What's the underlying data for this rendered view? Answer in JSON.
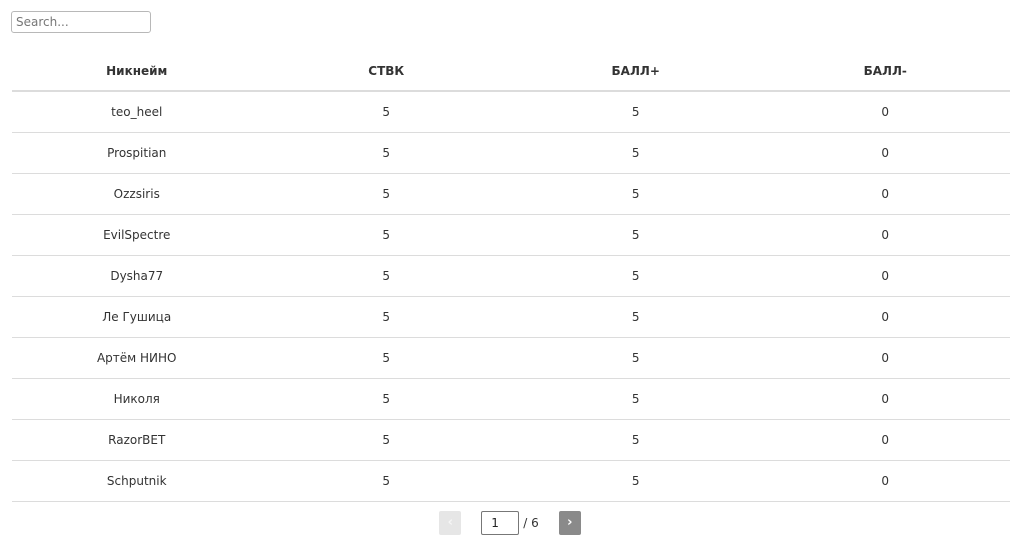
{
  "search": {
    "placeholder": "Search...",
    "value": ""
  },
  "table": {
    "columns": [
      "Никнейм",
      "СТВК",
      "БАЛЛ+",
      "БАЛЛ-"
    ],
    "rows": [
      [
        "teo_heel",
        "5",
        "5",
        "0"
      ],
      [
        "Prospitian",
        "5",
        "5",
        "0"
      ],
      [
        "Ozzsiris",
        "5",
        "5",
        "0"
      ],
      [
        "EvilSpectre",
        "5",
        "5",
        "0"
      ],
      [
        "Dysha77",
        "5",
        "5",
        "0"
      ],
      [
        "Ле Гушица",
        "5",
        "5",
        "0"
      ],
      [
        "Артём НИНО",
        "5",
        "5",
        "0"
      ],
      [
        "Николя",
        "5",
        "5",
        "0"
      ],
      [
        "RazorBET",
        "5",
        "5",
        "0"
      ],
      [
        "Schputnik",
        "5",
        "5",
        "0"
      ]
    ]
  },
  "pagination": {
    "prev_label": "‹",
    "next_label": "›",
    "current_page": "1",
    "total_label": "/ 6",
    "prev_icon": "chevron-left-icon",
    "next_icon": "chevron-right-icon"
  }
}
